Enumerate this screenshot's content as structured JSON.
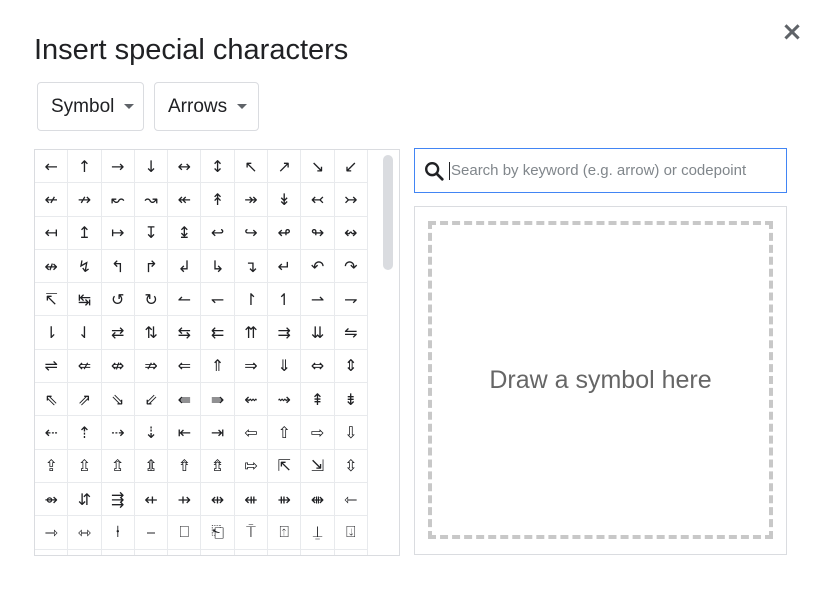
{
  "dialog": {
    "title": "Insert special characters",
    "close_label": "×"
  },
  "filters": {
    "category": "Symbol",
    "subcategory": "Arrows"
  },
  "search": {
    "placeholder": "Search by keyword (e.g. arrow) or codepoint",
    "value": ""
  },
  "draw": {
    "prompt": "Draw a symbol here"
  },
  "symbols": [
    "←",
    "↑",
    "→",
    "↓",
    "↔",
    "↕",
    "↖",
    "↗",
    "↘",
    "↙",
    "↚",
    "↛",
    "↜",
    "↝",
    "↞",
    "↟",
    "↠",
    "↡",
    "↢",
    "↣",
    "↤",
    "↥",
    "↦",
    "↧",
    "↨",
    "↩",
    "↪",
    "↫",
    "↬",
    "↭",
    "↮",
    "↯",
    "↰",
    "↱",
    "↲",
    "↳",
    "↴",
    "↵",
    "↶",
    "↷",
    "↸",
    "↹",
    "↺",
    "↻",
    "↼",
    "↽",
    "↾",
    "↿",
    "⇀",
    "⇁",
    "⇂",
    "⇃",
    "⇄",
    "⇅",
    "⇆",
    "⇇",
    "⇈",
    "⇉",
    "⇊",
    "⇋",
    "⇌",
    "⇍",
    "⇎",
    "⇏",
    "⇐",
    "⇑",
    "⇒",
    "⇓",
    "⇔",
    "⇕",
    "⇖",
    "⇗",
    "⇘",
    "⇙",
    "⇚",
    "⇛",
    "⇜",
    "⇝",
    "⇞",
    "⇟",
    "⇠",
    "⇡",
    "⇢",
    "⇣",
    "⇤",
    "⇥",
    "⇦",
    "⇧",
    "⇨",
    "⇩",
    "⇪",
    "⇫",
    "⇬",
    "⇭",
    "⇮",
    "⇯",
    "⇰",
    "⇱",
    "⇲",
    "⇳",
    "⇴",
    "⇵",
    "⇶",
    "⇷",
    "⇸",
    "⇹",
    "⇺",
    "⇻",
    "⇼",
    "⇽",
    "⇾",
    "⇿",
    "⍿",
    "⎯",
    "⎕",
    "⎗",
    "⍑",
    "⍐",
    "⍊",
    "⍗",
    "↔",
    "↕",
    "↖",
    "↗",
    "↘",
    "↙",
    "↚",
    "↛",
    "↜",
    "↝"
  ],
  "colors": {
    "accent": "#4285f4",
    "border": "#dadce0",
    "text": "#202124"
  }
}
